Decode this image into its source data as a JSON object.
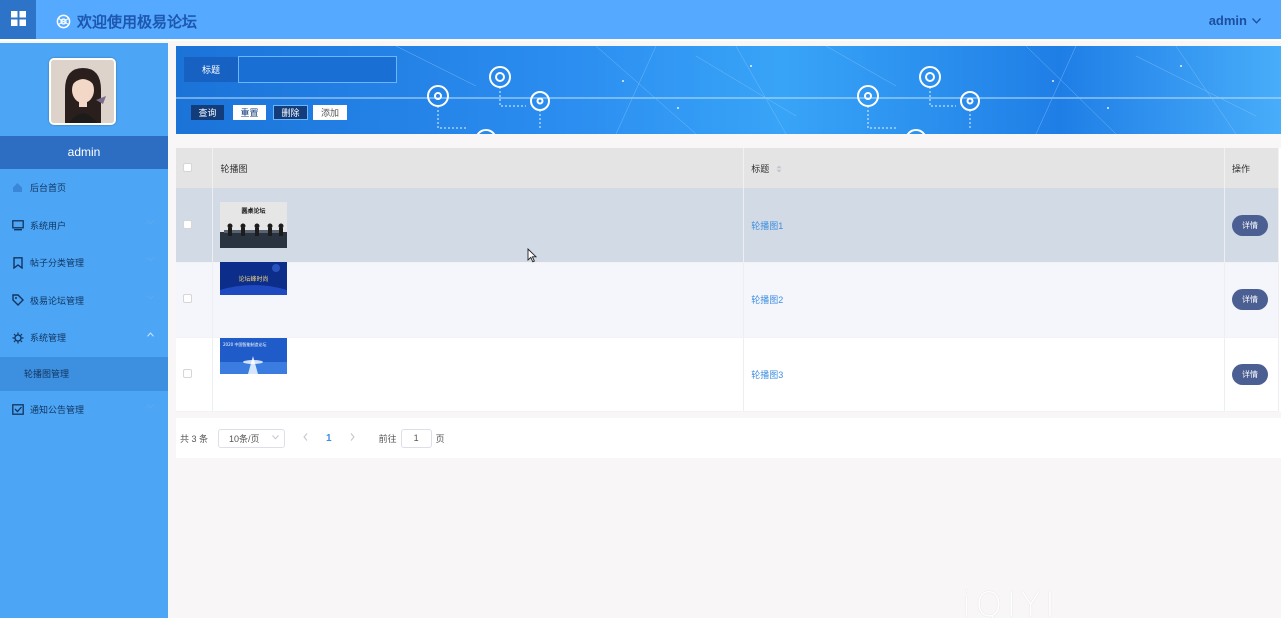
{
  "header": {
    "title": "欢迎使用极易论坛",
    "user": "admin",
    "accent": "#55aaff"
  },
  "sidebar": {
    "username": "admin",
    "items": [
      {
        "label": "后台首页",
        "icon": "home-icon"
      },
      {
        "label": "系统用户",
        "icon": "monitor-icon",
        "has_arrow": true
      },
      {
        "label": "帖子分类管理",
        "icon": "bookmark-icon",
        "has_arrow": true
      },
      {
        "label": "极易论坛管理",
        "icon": "tag-icon",
        "has_arrow": true
      },
      {
        "label": "系统管理",
        "icon": "gear-icon",
        "expanded": true
      },
      {
        "label": "通知公告管理",
        "icon": "inbox-icon",
        "has_arrow": true
      }
    ],
    "subitems": [
      {
        "label": "轮播图管理",
        "active": true
      }
    ]
  },
  "search": {
    "title_label": "标题",
    "title_value": "",
    "query_label": "查询",
    "reset_label": "重置",
    "delete_label": "删除",
    "add_label": "添加"
  },
  "table": {
    "headers": [
      "轮播图",
      "标题",
      "操作"
    ],
    "rows": [
      {
        "image_text": "圆桌论坛",
        "title": "轮播图1",
        "action": "详情",
        "image_colors": [
          "#d8d8d8",
          "#26303c"
        ]
      },
      {
        "image_text": "论坛峰时尚",
        "title": "轮播图2",
        "action": "详情",
        "image_colors": [
          "#0c2e8a",
          "#1f49c0"
        ]
      },
      {
        "image_text": "2020 中国智能制造论坛",
        "title": "轮播图3",
        "action": "详情",
        "image_colors": [
          "#1f5cc9",
          "#3a7ce0"
        ]
      }
    ]
  },
  "pagination": {
    "total_text": "共 3 条",
    "page_size": "10条/页",
    "current_page": "1",
    "goto_prefix": "前往",
    "goto_value": "1",
    "goto_suffix": "页"
  },
  "watermark": "iQIYI"
}
